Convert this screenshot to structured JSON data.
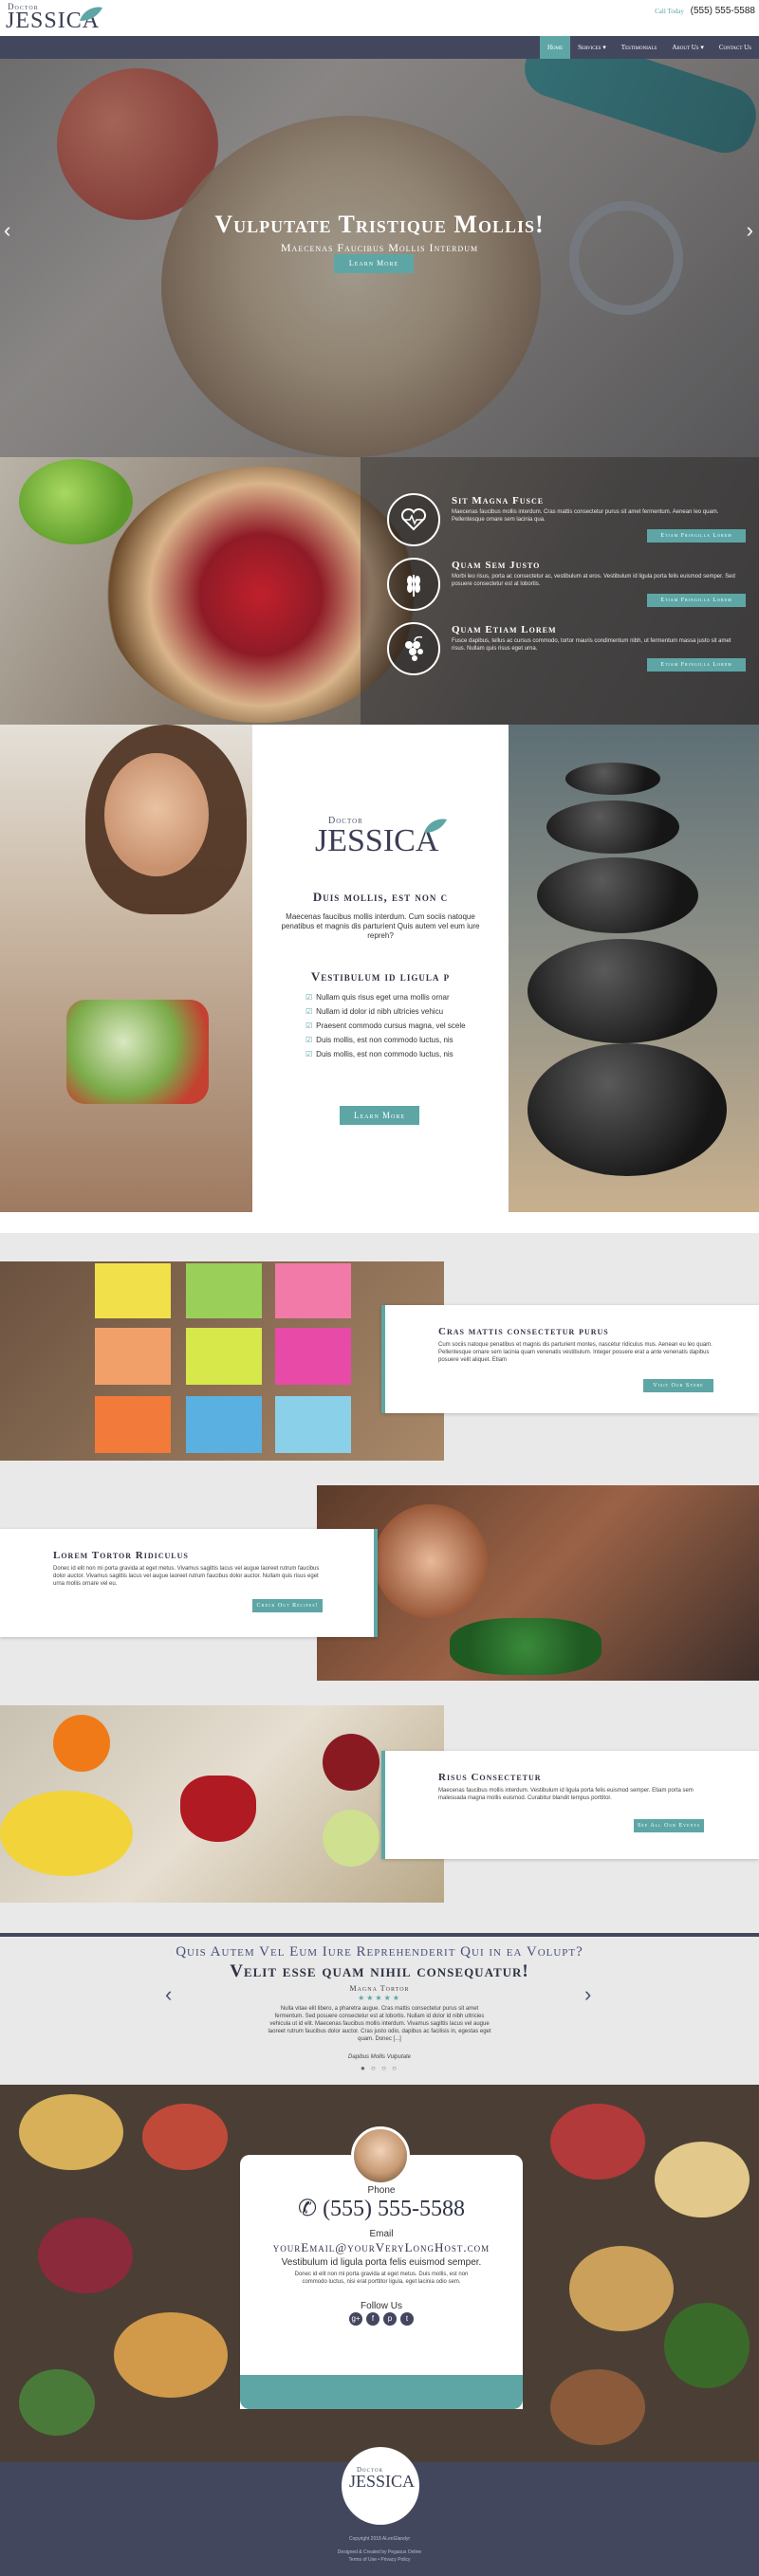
{
  "header": {
    "logo_top": "Doctor",
    "logo_name": "JESSICA",
    "call_label": "Call Today",
    "call_number": "(555) 555-5588"
  },
  "nav": {
    "items": [
      "Home",
      "Services",
      "Testimonials",
      "About Us",
      "Contact Us"
    ],
    "active": "Home"
  },
  "hero": {
    "title": "Vulputate Tristique Mollis!",
    "subtitle": "Maecenas Faucibus Mollis Interdum",
    "button": "Learn More"
  },
  "features": [
    {
      "icon": "heart-pulse-icon",
      "title": "Sit Magna Fusce",
      "text": "Maecenas faucibus mollis interdum. Cras mattis consectetur purus sit amet fermentum. Aenean leo quam. Pellentesque ornare sem lacinia qua.",
      "button": "Etiam Fringilla Lorem"
    },
    {
      "icon": "wheat-icon",
      "title": "Quam Sem Justo",
      "text": "Morbi leo risus, porta ac consectetur ac, vestibulum at eros. Vestibulum id ligula porta felis euismod semper. Sed posuere consectetur est at lobortis.",
      "button": "Etiam Fringilla Lorem"
    },
    {
      "icon": "grapes-icon",
      "title": "Quam Etiam Lorem",
      "text": "Fusce dapibus, tellus ac cursus commodo, tortor mauris condimentum nibh, ut fermentum massa justo sit amet risus. Nullam quis risus eget urna.",
      "button": "Etiam Fringilla Lorem"
    }
  ],
  "about": {
    "logo_top": "Doctor",
    "logo_name": "JESSICA",
    "heading1": "Duis mollis, est non c",
    "intro": "Maecenas faucibus mollis interdum. Cum sociis natoque penatibus et magnis dis parturient Quis autem vel eum iure repreh?",
    "heading2": "Vestibulum id ligula p",
    "list": [
      "Nullam quis risus eget urna mollis ornar",
      "Nullam id dolor id nibh ultricies vehicu",
      "Praesent commodo cursus magna, vel scele",
      "Duis mollis, est non commodo luctus, nis",
      "Duis mollis, est non commodo luctus, nis"
    ],
    "button": "Learn More"
  },
  "cards": [
    {
      "title": "Cras mattis consectetur purus",
      "text": "Cum sociis natoque penatibus et magnis dis parturient montes, nascetur ridiculus mus. Aenean eu leo quam. Pellentesque ornare sem lacinia quam venenatis vestibulum. Integer posuere erat a ante venenatis dapibus posuere velit aliquet. Etiam",
      "button": "Visit Our Store"
    },
    {
      "title": "Lorem Tortor Ridiculus",
      "text": "Donec id elit non mi porta gravida at eget metus. Vivamus sagittis lacus vel augue laoreet rutrum faucibus dolor auctor. Vivamus sagittis lacus vel augue laoreet rutrum faucibus dolor auctor. Nullam quis risus eget urna mollis ornare vel eu.",
      "button": "Check Out Recipes!"
    },
    {
      "title": "Risus Consectetur",
      "text": "Maecenas faucibus mollis interdum. Vestibulum id ligula porta felis euismod semper. Etiam porta sem malesuada magna mollis euismod. Curabitur blandit tempus porttitor.",
      "button": "See All Our Events"
    }
  ],
  "testimonial": {
    "question": "Quis Autem Vel Eum Iure Reprehenderit Qui in ea Volupt?",
    "headline": "Velit esse quam nihil consequatur!",
    "name": "Magna Tortor",
    "stars": "★★★★★",
    "body": "Nulla vitae elit libero, a pharetra augue. Cras mattis consectetur purus sit amet fermentum. Sed posuere consectetur est at lobortis. Nullam id dolor id nibh ultricies vehicula ut id elit. Maecenas faucibus mollis interdum. Vivamus sagittis lacus vel augue laoreet rutrum faucibus dolor auctor. Cras justo odio, dapibus ac facilisis in, egestas eget quam. Donec [...]",
    "author": "Dapibus Mollis Vulputate",
    "dots": "● ○ ○ ○"
  },
  "contact": {
    "phone_label": "Phone",
    "phone": "(555) 555-5588",
    "email_label": "Email",
    "email": "yourEmail@yourVeryLongHost.com",
    "tagline": "Vestibulum id ligula porta felis euismod semper.",
    "blurb": "Donec id elit non mi porta gravida at eget metus. Duis mollis, est non commodo luctus, nisi erat porttitor ligula, eget lacinia odio sem.",
    "follow": "Follow Us",
    "social": [
      "g+",
      "f",
      "p",
      "t"
    ]
  },
  "footer": {
    "logo_top": "Doctor",
    "logo_name": "JESSICA",
    "copyright": "Copyright 2018 ALenGlandyr",
    "credit": "Designed & Created by Pegasus Online",
    "links": "Terms of Use • Privacy Policy"
  },
  "colors": {
    "accent": "#5ea6a6",
    "navy": "#43475e",
    "text": "#2f3344"
  }
}
